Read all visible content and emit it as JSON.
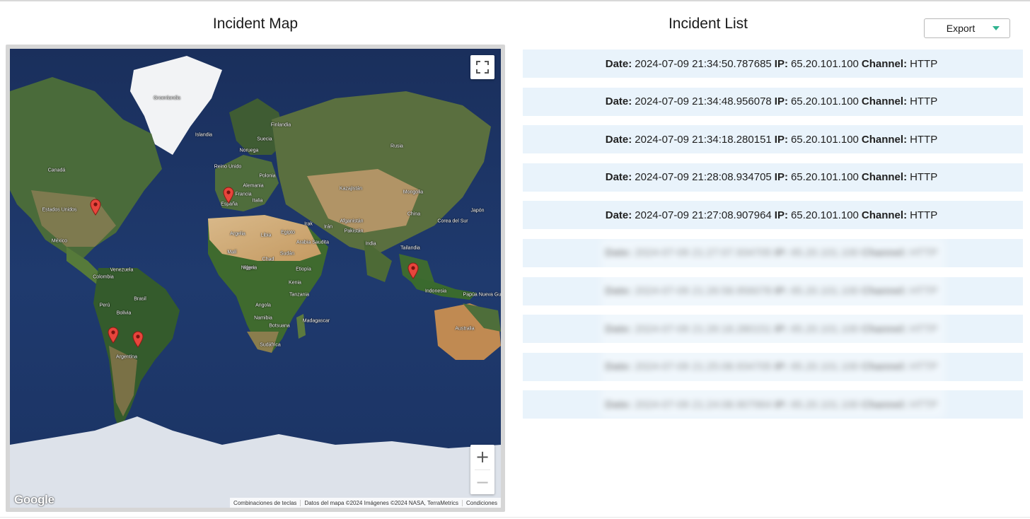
{
  "map_section": {
    "title": "Incident Map",
    "google_logo": "Google",
    "attribution": [
      "Combinaciones de teclas",
      "Datos del mapa ©2024 Imágenes ©2024 NASA, TerraMetrics",
      "Condiciones"
    ],
    "fullscreen_icon": "fullscreen-icon",
    "zoom_in_label": "+",
    "zoom_out_label": "−",
    "marker_color": "#e8453c",
    "labels": [
      "Groenlandia",
      "Islandia",
      "Finlandia",
      "Suecia",
      "Noruega",
      "Rusia",
      "Reino Unido",
      "Polonia",
      "Alemania",
      "Francia",
      "España",
      "Italia",
      "Kazajistán",
      "Mongolia",
      "Canadá",
      "Estados Unidos",
      "México",
      "Argelia",
      "Libia",
      "Egipto",
      "Irak",
      "Irán",
      "Afganistán",
      "Pakistán",
      "China",
      "Corea del Sur",
      "Japón",
      "Arabia Saudita",
      "India",
      "Malí",
      "Níger",
      "Chad",
      "Sudán",
      "Tailandia",
      "Nigeria",
      "Etiopía",
      "Venezuela",
      "Colombia",
      "Kenia",
      "Indonesia",
      "Papúa Nueva Guinea",
      "Brasil",
      "Perú",
      "Bolivia",
      "Tanzania",
      "Angola",
      "Namibia",
      "Botsuana",
      "Madagascar",
      "Australia",
      "Sudáfrica",
      "Argentina"
    ]
  },
  "list_section": {
    "title": "Incident List",
    "export_label": "Export",
    "date_label": "Date:",
    "ip_label": "IP:",
    "channel_label": "Channel:",
    "incidents": [
      {
        "date": "2024-07-09 21:34:50.787685",
        "ip": "65.20.101.100",
        "channel": "HTTP"
      },
      {
        "date": "2024-07-09 21:34:48.956078",
        "ip": "65.20.101.100",
        "channel": "HTTP"
      },
      {
        "date": "2024-07-09 21:34:18.280151",
        "ip": "65.20.101.100",
        "channel": "HTTP"
      },
      {
        "date": "2024-07-09 21:28:08.934705",
        "ip": "65.20.101.100",
        "channel": "HTTP"
      },
      {
        "date": "2024-07-09 21:27:08.907964",
        "ip": "65.20.101.100",
        "channel": "HTTP"
      },
      {
        "date": "2024-07-09 21:27:07.934705",
        "ip": "65.20.101.100",
        "channel": "HTTP"
      },
      {
        "date": "2024-07-09 21:26:58.956078",
        "ip": "65.20.101.100",
        "channel": "HTTP"
      },
      {
        "date": "2024-07-09 21:26:18.280151",
        "ip": "65.20.101.100",
        "channel": "HTTP"
      },
      {
        "date": "2024-07-09 21:25:08.934705",
        "ip": "65.20.101.100",
        "channel": "HTTP"
      },
      {
        "date": "2024-07-09 21:24:08.907964",
        "ip": "65.20.101.100",
        "channel": "HTTP"
      }
    ]
  },
  "colors": {
    "row_background": "#e9f3fb",
    "export_caret": "#2fb38f",
    "ocean": "#1d3566"
  }
}
